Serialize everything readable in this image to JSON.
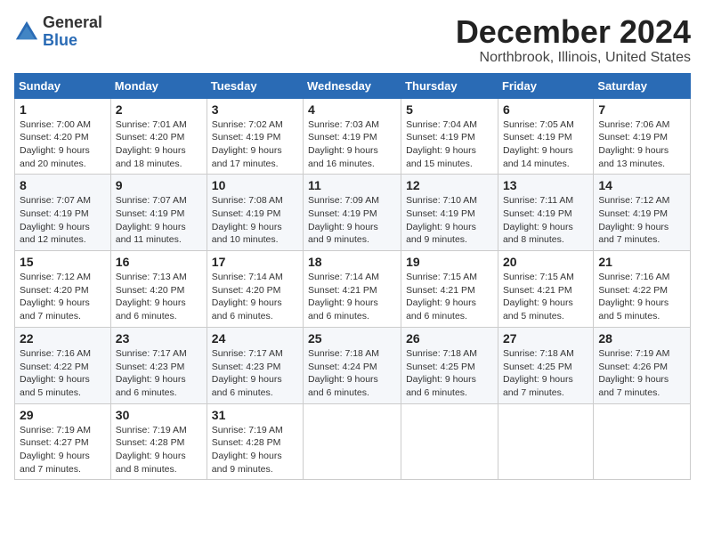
{
  "logo": {
    "general": "General",
    "blue": "Blue"
  },
  "title": "December 2024",
  "subtitle": "Northbrook, Illinois, United States",
  "headers": [
    "Sunday",
    "Monday",
    "Tuesday",
    "Wednesday",
    "Thursday",
    "Friday",
    "Saturday"
  ],
  "weeks": [
    [
      {
        "day": "1",
        "info": "Sunrise: 7:00 AM\nSunset: 4:20 PM\nDaylight: 9 hours\nand 20 minutes."
      },
      {
        "day": "2",
        "info": "Sunrise: 7:01 AM\nSunset: 4:20 PM\nDaylight: 9 hours\nand 18 minutes."
      },
      {
        "day": "3",
        "info": "Sunrise: 7:02 AM\nSunset: 4:19 PM\nDaylight: 9 hours\nand 17 minutes."
      },
      {
        "day": "4",
        "info": "Sunrise: 7:03 AM\nSunset: 4:19 PM\nDaylight: 9 hours\nand 16 minutes."
      },
      {
        "day": "5",
        "info": "Sunrise: 7:04 AM\nSunset: 4:19 PM\nDaylight: 9 hours\nand 15 minutes."
      },
      {
        "day": "6",
        "info": "Sunrise: 7:05 AM\nSunset: 4:19 PM\nDaylight: 9 hours\nand 14 minutes."
      },
      {
        "day": "7",
        "info": "Sunrise: 7:06 AM\nSunset: 4:19 PM\nDaylight: 9 hours\nand 13 minutes."
      }
    ],
    [
      {
        "day": "8",
        "info": "Sunrise: 7:07 AM\nSunset: 4:19 PM\nDaylight: 9 hours\nand 12 minutes."
      },
      {
        "day": "9",
        "info": "Sunrise: 7:07 AM\nSunset: 4:19 PM\nDaylight: 9 hours\nand 11 minutes."
      },
      {
        "day": "10",
        "info": "Sunrise: 7:08 AM\nSunset: 4:19 PM\nDaylight: 9 hours\nand 10 minutes."
      },
      {
        "day": "11",
        "info": "Sunrise: 7:09 AM\nSunset: 4:19 PM\nDaylight: 9 hours\nand 9 minutes."
      },
      {
        "day": "12",
        "info": "Sunrise: 7:10 AM\nSunset: 4:19 PM\nDaylight: 9 hours\nand 9 minutes."
      },
      {
        "day": "13",
        "info": "Sunrise: 7:11 AM\nSunset: 4:19 PM\nDaylight: 9 hours\nand 8 minutes."
      },
      {
        "day": "14",
        "info": "Sunrise: 7:12 AM\nSunset: 4:19 PM\nDaylight: 9 hours\nand 7 minutes."
      }
    ],
    [
      {
        "day": "15",
        "info": "Sunrise: 7:12 AM\nSunset: 4:20 PM\nDaylight: 9 hours\nand 7 minutes."
      },
      {
        "day": "16",
        "info": "Sunrise: 7:13 AM\nSunset: 4:20 PM\nDaylight: 9 hours\nand 6 minutes."
      },
      {
        "day": "17",
        "info": "Sunrise: 7:14 AM\nSunset: 4:20 PM\nDaylight: 9 hours\nand 6 minutes."
      },
      {
        "day": "18",
        "info": "Sunrise: 7:14 AM\nSunset: 4:21 PM\nDaylight: 9 hours\nand 6 minutes."
      },
      {
        "day": "19",
        "info": "Sunrise: 7:15 AM\nSunset: 4:21 PM\nDaylight: 9 hours\nand 6 minutes."
      },
      {
        "day": "20",
        "info": "Sunrise: 7:15 AM\nSunset: 4:21 PM\nDaylight: 9 hours\nand 5 minutes."
      },
      {
        "day": "21",
        "info": "Sunrise: 7:16 AM\nSunset: 4:22 PM\nDaylight: 9 hours\nand 5 minutes."
      }
    ],
    [
      {
        "day": "22",
        "info": "Sunrise: 7:16 AM\nSunset: 4:22 PM\nDaylight: 9 hours\nand 5 minutes."
      },
      {
        "day": "23",
        "info": "Sunrise: 7:17 AM\nSunset: 4:23 PM\nDaylight: 9 hours\nand 6 minutes."
      },
      {
        "day": "24",
        "info": "Sunrise: 7:17 AM\nSunset: 4:23 PM\nDaylight: 9 hours\nand 6 minutes."
      },
      {
        "day": "25",
        "info": "Sunrise: 7:18 AM\nSunset: 4:24 PM\nDaylight: 9 hours\nand 6 minutes."
      },
      {
        "day": "26",
        "info": "Sunrise: 7:18 AM\nSunset: 4:25 PM\nDaylight: 9 hours\nand 6 minutes."
      },
      {
        "day": "27",
        "info": "Sunrise: 7:18 AM\nSunset: 4:25 PM\nDaylight: 9 hours\nand 7 minutes."
      },
      {
        "day": "28",
        "info": "Sunrise: 7:19 AM\nSunset: 4:26 PM\nDaylight: 9 hours\nand 7 minutes."
      }
    ],
    [
      {
        "day": "29",
        "info": "Sunrise: 7:19 AM\nSunset: 4:27 PM\nDaylight: 9 hours\nand 7 minutes."
      },
      {
        "day": "30",
        "info": "Sunrise: 7:19 AM\nSunset: 4:28 PM\nDaylight: 9 hours\nand 8 minutes."
      },
      {
        "day": "31",
        "info": "Sunrise: 7:19 AM\nSunset: 4:28 PM\nDaylight: 9 hours\nand 9 minutes."
      },
      null,
      null,
      null,
      null
    ]
  ]
}
